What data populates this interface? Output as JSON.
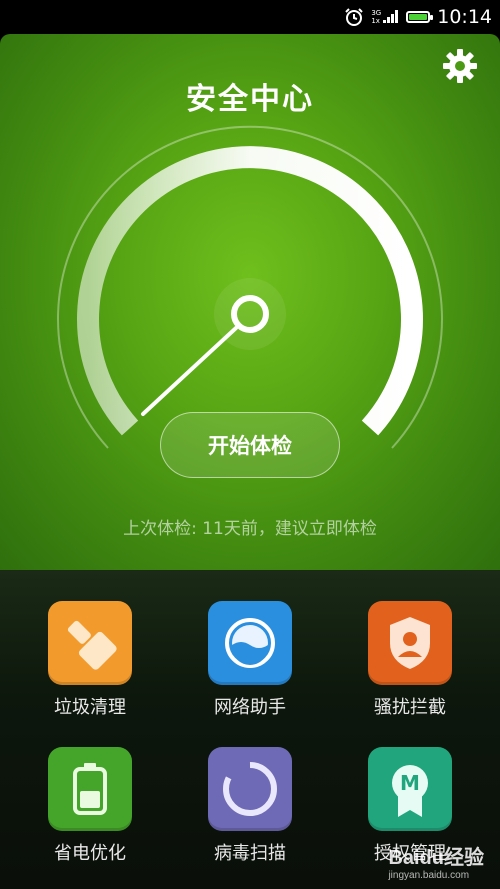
{
  "status_bar": {
    "time": "10:14",
    "network_top": "3G",
    "network_bottom": "1x"
  },
  "header": {
    "title": "安全中心",
    "settings_icon": "gear-icon"
  },
  "gauge": {
    "check_button_label": "开始体检",
    "last_check_text": "上次体检: 11天前，建议立即体检"
  },
  "tools": [
    {
      "label": "垃圾清理",
      "icon": "broom-icon",
      "color": "#f39a2c"
    },
    {
      "label": "网络助手",
      "icon": "network-icon",
      "color": "#2b8fe0"
    },
    {
      "label": "骚扰拦截",
      "icon": "shield-user-icon",
      "color": "#e2621d"
    },
    {
      "label": "省电优化",
      "icon": "battery-icon",
      "color": "#45a52a"
    },
    {
      "label": "病毒扫描",
      "icon": "scan-icon",
      "color": "#6f6ab6"
    },
    {
      "label": "授权管理",
      "icon": "badge-m-icon",
      "color": "#21a57d"
    }
  ],
  "watermark": {
    "brand": "Baidu经验",
    "url": "jingyan.baidu.com"
  }
}
